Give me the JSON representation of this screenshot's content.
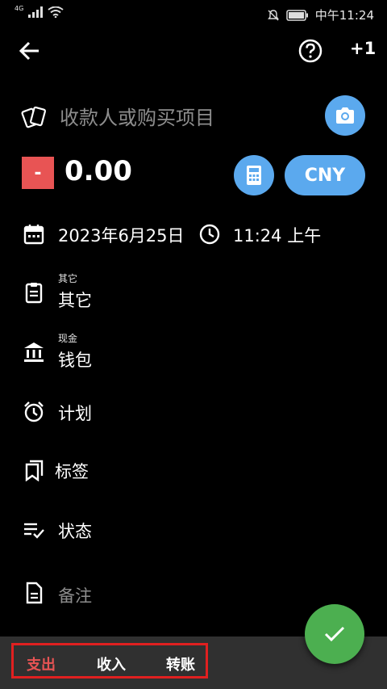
{
  "status_bar": {
    "network": "4G",
    "time": "中午11:24"
  },
  "app_bar": {
    "back_icon": "arrow-left-icon",
    "help_icon": "help-circle-icon",
    "plus_one": "+1"
  },
  "payee": {
    "icon": "receipt-icon",
    "placeholder": "收款人或购买项目",
    "value": "",
    "camera_icon": "camera-icon"
  },
  "amount": {
    "sign": "-",
    "value": "0.00",
    "calculator_icon": "calculator-icon",
    "currency": "CNY",
    "sign_color": "#e85454",
    "accent": "#5ba9ee"
  },
  "datetime": {
    "date": "2023年6月25日",
    "time": "11:24 上午"
  },
  "category": {
    "caption": "其它",
    "value": "其它"
  },
  "account": {
    "caption": "现金",
    "value": "钱包"
  },
  "plan": {
    "label": "计划"
  },
  "tags": {
    "label": "标签"
  },
  "status": {
    "label": "状态"
  },
  "note": {
    "placeholder": "备注"
  },
  "fab": {
    "icon": "check-icon",
    "color": "#4caf50"
  },
  "bottom_tabs": [
    {
      "label": "支出",
      "active": true
    },
    {
      "label": "收入",
      "active": false
    },
    {
      "label": "转账",
      "active": false
    }
  ]
}
